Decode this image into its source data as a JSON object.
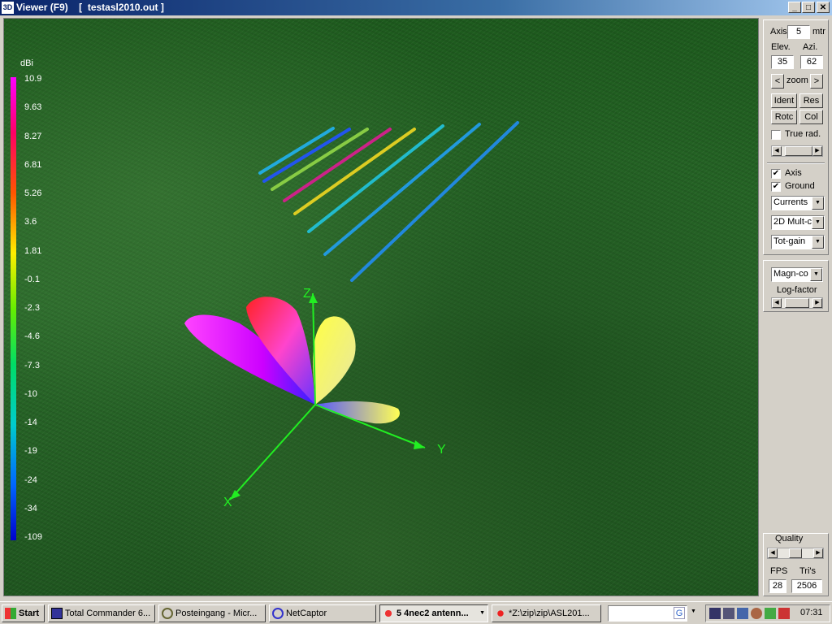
{
  "window": {
    "title": "Viewer (F9)",
    "document": "[  testasl2010.out ]",
    "icon_text": "3D",
    "controls": {
      "minimize": "_",
      "maximize": "□",
      "close": "✕"
    }
  },
  "colorscale": {
    "unit": "dBi",
    "labels": [
      "10.9",
      "9.63",
      "8.27",
      "6.81",
      "5.26",
      "3.6",
      "1.81",
      "-0.1",
      "-2.3",
      "-4.6",
      "-7.3",
      "-10",
      "-14",
      "-19",
      "-24",
      "-34",
      "-109"
    ]
  },
  "axes": {
    "x": "X",
    "y": "Y",
    "z": "Z"
  },
  "controls": {
    "axis_label": "Axis",
    "axis_value": "5",
    "axis_unit": "mtr",
    "elev_label": "Elev.",
    "elev_value": "35",
    "azi_label": "Azi.",
    "azi_value": "62",
    "zoom_left": "<",
    "zoom_label": "zoom",
    "zoom_right": ">",
    "ident": "Ident",
    "res": "Res",
    "rotc": "Rotc",
    "col": "Col",
    "true_rad": "True rad.",
    "true_rad_checked": false,
    "axis_chk": "Axis",
    "axis_checked": true,
    "ground_chk": "Ground",
    "ground_checked": true,
    "combo1": "Currents",
    "combo2": "2D Mult-c",
    "combo3": "Tot-gain",
    "combo4": "Magn-co",
    "log_factor": "Log-factor",
    "quality": "Quality",
    "fps_label": "FPS",
    "tris_label": "Tri's",
    "fps_value": "28",
    "tris_value": "2506",
    "scroll_left": "◀",
    "scroll_right": "▶",
    "arrow_down": "▼"
  },
  "taskbar": {
    "start": "Start",
    "items": [
      "Total Commander 6...",
      "Posteingang - Micr...",
      "NetCaptor",
      "5 4nec2 antenn...",
      "*Z:\\zip\\zip\\ASL201..."
    ],
    "search_icon": "G",
    "search_arrow": "▼",
    "item_arrow": "▼",
    "clock": "07:31"
  }
}
